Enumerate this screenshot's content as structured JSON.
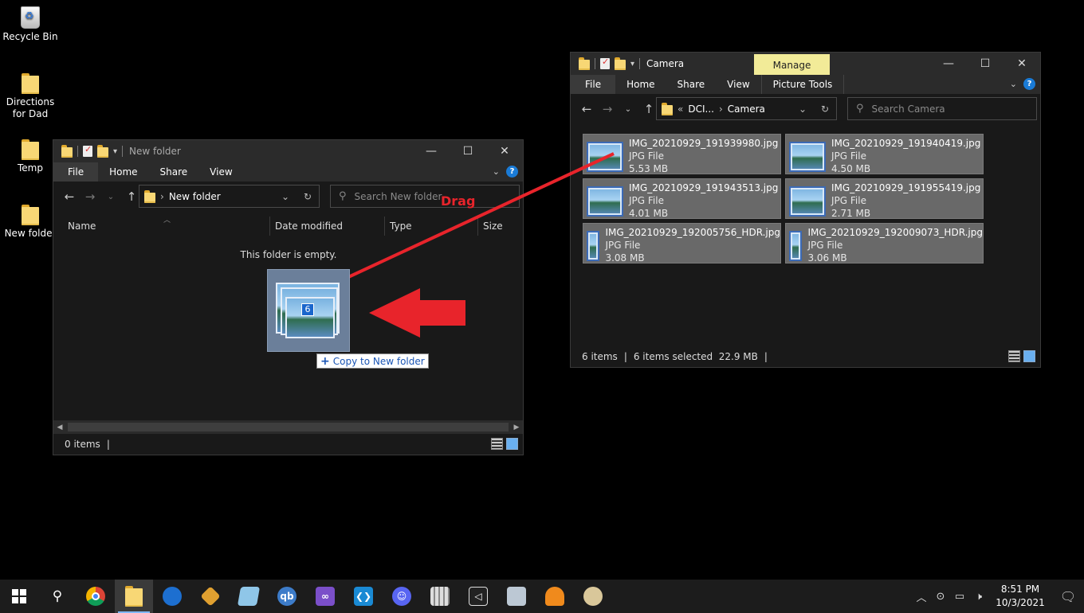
{
  "desktop": {
    "icons": [
      {
        "label": "Recycle Bin",
        "icon": "recycle-bin-icon"
      },
      {
        "label": "Directions for Dad",
        "icon": "folder-icon"
      },
      {
        "label": "Temp",
        "icon": "folder-icon"
      },
      {
        "label": "New folder",
        "icon": "folder-icon"
      }
    ]
  },
  "left_window": {
    "title": "New folder",
    "tabs": [
      "File",
      "Home",
      "Share",
      "View"
    ],
    "address": "New folder",
    "search_placeholder": "Search New folder",
    "columns": [
      "Name",
      "Date modified",
      "Type",
      "Size"
    ],
    "empty_message": "This folder is empty.",
    "status_items": "0 items"
  },
  "right_window": {
    "title": "Camera",
    "contextual_tab": "Manage",
    "tabs": [
      "File",
      "Home",
      "Share",
      "View",
      "Picture Tools"
    ],
    "address_parent": "DCI...",
    "address_current": "Camera",
    "address_prefix": "«",
    "search_placeholder": "Search Camera",
    "files": [
      {
        "name": "IMG_20210929_191939980.jpg",
        "type": "JPG File",
        "size": "5.53 MB"
      },
      {
        "name": "IMG_20210929_191940419.jpg",
        "type": "JPG File",
        "size": "4.50 MB"
      },
      {
        "name": "IMG_20210929_191943513.jpg",
        "type": "JPG File",
        "size": "4.01 MB"
      },
      {
        "name": "IMG_20210929_191955419.jpg",
        "type": "JPG File",
        "size": "2.71 MB"
      },
      {
        "name": "IMG_20210929_192005756_HDR.jpg",
        "type": "JPG File",
        "size": "3.08 MB"
      },
      {
        "name": "IMG_20210929_192009073_HDR.jpg",
        "type": "JPG File",
        "size": "3.06 MB"
      }
    ],
    "status_items": "6 items",
    "status_selected": "6 items selected  22.9 MB"
  },
  "drag": {
    "count": "6",
    "tooltip": "Copy to New folder",
    "annotation_label": "Drag",
    "annotation_color": "#e8242b"
  },
  "taskbar": {
    "apps": [
      "chrome-icon",
      "file-explorer-icon",
      "edge-icon",
      "app-icon",
      "notepad-icon",
      "qbittorrent-icon",
      "visual-studio-icon",
      "vscode-icon",
      "discord-icon",
      "calculator-icon",
      "unity-icon",
      "app-icon",
      "fl-studio-icon",
      "paint-icon"
    ],
    "qbittorrent_label": "qb",
    "time": "8:51 PM",
    "date": "10/3/2021"
  }
}
